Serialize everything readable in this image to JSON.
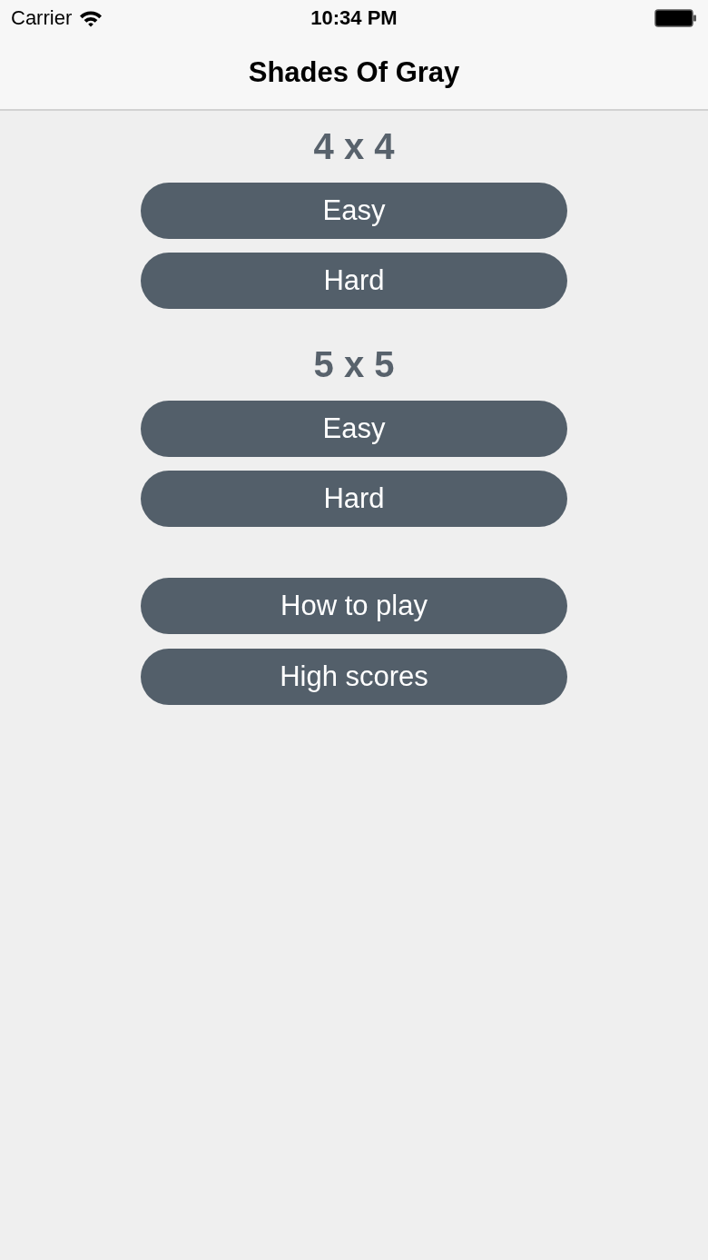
{
  "status_bar": {
    "carrier": "Carrier",
    "time": "10:34 PM"
  },
  "nav_bar": {
    "title": "Shades Of Gray"
  },
  "sections": [
    {
      "heading": "4 x 4",
      "buttons": [
        "Easy",
        "Hard"
      ]
    },
    {
      "heading": "5 x 5",
      "buttons": [
        "Easy",
        "Hard"
      ]
    }
  ],
  "menu_buttons": [
    "How to play",
    "High scores"
  ]
}
